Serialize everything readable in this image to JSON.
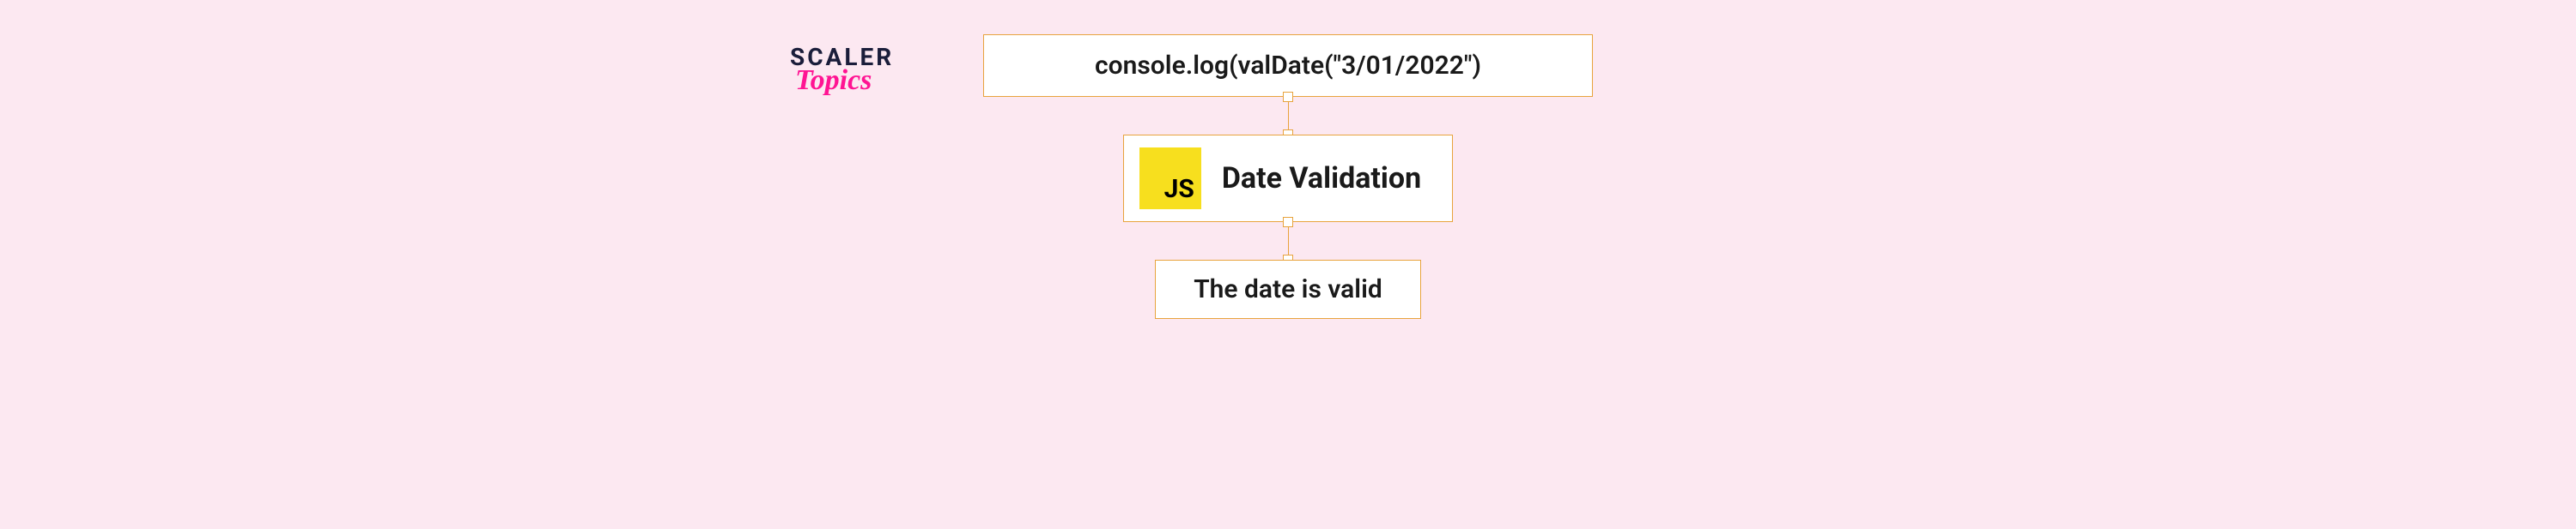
{
  "logo": {
    "brand": "SCALER",
    "sub": "Topics"
  },
  "diagram": {
    "top_box": "console.log(valDate(\"3/01/2022\")",
    "js_badge": "JS",
    "middle_box": "Date Validation",
    "bottom_box": "The date is valid"
  }
}
